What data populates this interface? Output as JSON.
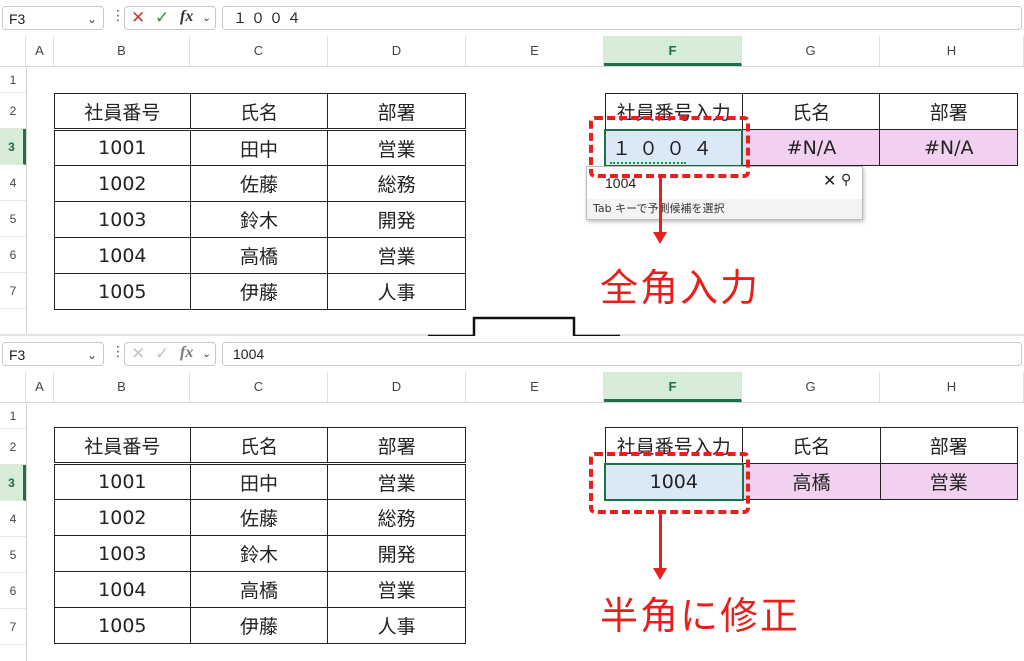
{
  "panels": [
    {
      "name_box": "F3",
      "formula": "１００４",
      "formula_buttons_active": true,
      "columns": [
        "A",
        "B",
        "C",
        "D",
        "E",
        "F",
        "G",
        "H"
      ],
      "rows": [
        "1",
        "2",
        "3",
        "4",
        "5",
        "6",
        "7"
      ],
      "left_table": {
        "header": [
          "社員番号",
          "氏名",
          "部署"
        ],
        "rows": [
          [
            "1001",
            "田中",
            "営業"
          ],
          [
            "1002",
            "佐藤",
            "総務"
          ],
          [
            "1003",
            "鈴木",
            "開発"
          ],
          [
            "1004",
            "高橋",
            "営業"
          ],
          [
            "1005",
            "伊藤",
            "人事"
          ]
        ]
      },
      "lookup_table": {
        "header": [
          "社員番号入力",
          "氏名",
          "部署"
        ],
        "input": "１００４",
        "results": [
          "#N/A",
          "#N/A"
        ]
      },
      "autocomplete": {
        "value": "1004",
        "close_icon": "close-icon",
        "search_icon": "search-icon",
        "hint": "Tab キーで予測候補を選択"
      },
      "annotation": "全角入力"
    },
    {
      "name_box": "F3",
      "formula": "1004",
      "formula_buttons_active": false,
      "columns": [
        "A",
        "B",
        "C",
        "D",
        "E",
        "F",
        "G",
        "H"
      ],
      "rows": [
        "1",
        "2",
        "3",
        "4",
        "5",
        "6",
        "7"
      ],
      "left_table": {
        "header": [
          "社員番号",
          "氏名",
          "部署"
        ],
        "rows": [
          [
            "1001",
            "田中",
            "営業"
          ],
          [
            "1002",
            "佐藤",
            "総務"
          ],
          [
            "1003",
            "鈴木",
            "開発"
          ],
          [
            "1004",
            "高橋",
            "営業"
          ],
          [
            "1005",
            "伊藤",
            "人事"
          ]
        ]
      },
      "lookup_table": {
        "header": [
          "社員番号入力",
          "氏名",
          "部署"
        ],
        "input": "1004",
        "results": [
          "高橋",
          "営業"
        ]
      },
      "annotation": "半角に修正"
    }
  ],
  "colors": {
    "accent_red": "#e8201c",
    "lookup_pink": "#f2d0f0",
    "selected_blue": "#dbe9f6",
    "excel_green": "#1e7145"
  }
}
